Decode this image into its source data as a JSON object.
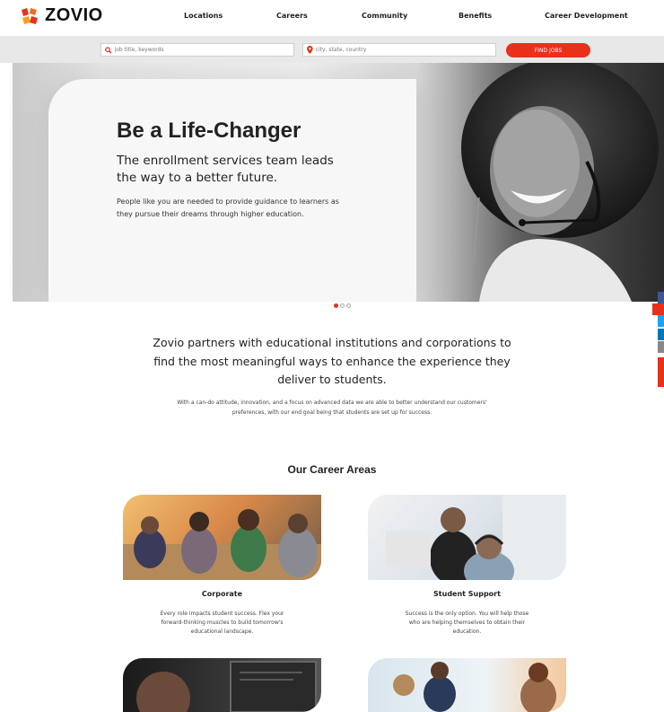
{
  "brand": {
    "name": "ZOVIO",
    "accent": "#e9301b"
  },
  "nav": {
    "links": [
      "Locations",
      "Careers",
      "Community",
      "Benefits",
      "Career Development"
    ]
  },
  "search": {
    "keyword_placeholder": "job title, keywords",
    "location_placeholder": "city, state, country",
    "button_label": "FIND JOBS",
    "search_icon": "search-icon",
    "location_icon": "map-pin-icon"
  },
  "hero": {
    "title": "Be a Life-Changer",
    "subtitle": "The enrollment services team leads the way to a better future.",
    "body": "People like you are needed to provide guidance to learners as they pursue their dreams through higher education.",
    "carousel": {
      "slides": 3,
      "active": 1
    }
  },
  "intro": {
    "headline": "Zovio partners with educational institutions and corporations to find the most meaningful ways to enhance the experience they deliver to students.",
    "body": "With a can-do attitude, innovation, and a focus on advanced data we are able to better understand our customers' preferences, with our end goal being that students are set up for success."
  },
  "career_areas": {
    "title": "Our Career Areas",
    "cards": [
      {
        "title": "Corporate",
        "description": "Every role impacts student success. Flex your forward-thinking muscles to build tomorrow's educational landscape."
      },
      {
        "title": "Student Support",
        "description": "Success is the only option. You will help those who are helping themselves to obtain their education."
      }
    ]
  },
  "side_share_colors": [
    "#3b5998",
    "#1da1f2",
    "#0077b5",
    "#888888",
    "#e9301b"
  ]
}
